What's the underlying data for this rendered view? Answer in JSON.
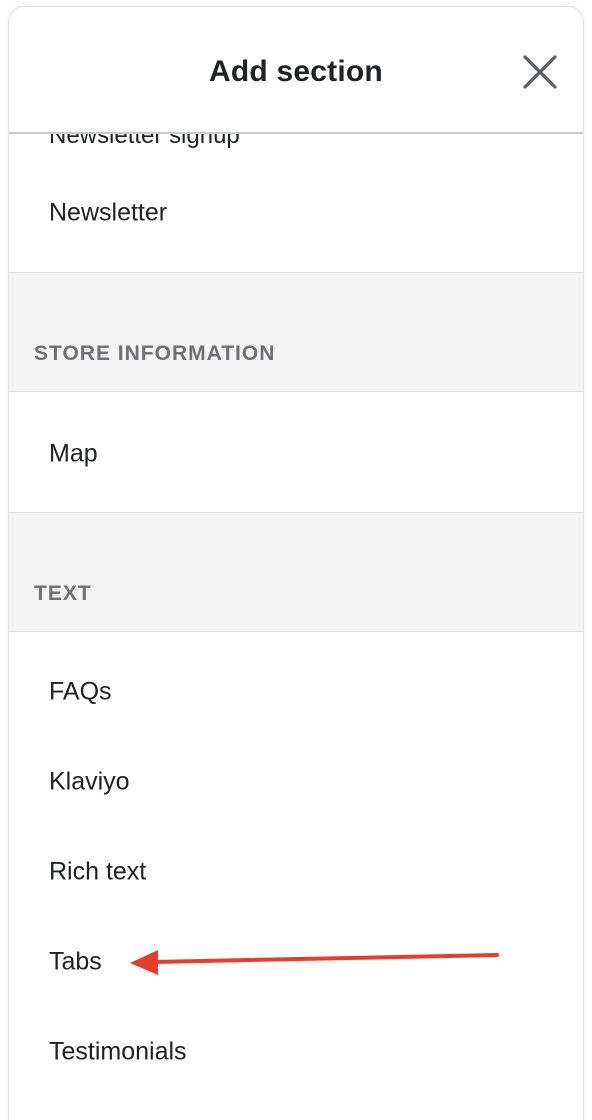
{
  "header": {
    "title": "Add section",
    "close_icon": "close-icon"
  },
  "sections": {
    "partial_item": "Newsletter signup",
    "newsletter": "Newsletter",
    "store_information": {
      "heading": "STORE INFORMATION",
      "items": [
        "Map"
      ]
    },
    "text": {
      "heading": "TEXT",
      "items": [
        "FAQs",
        "Klaviyo",
        "Rich text",
        "Tabs",
        "Testimonials"
      ]
    }
  },
  "annotation": {
    "arrow_color": "#e53e2e",
    "points_to": "Tabs"
  },
  "colors": {
    "text": "#202223",
    "muted_heading": "#6d7175",
    "group_bg": "#f4f4f4",
    "divider": "#e1e3e5"
  }
}
